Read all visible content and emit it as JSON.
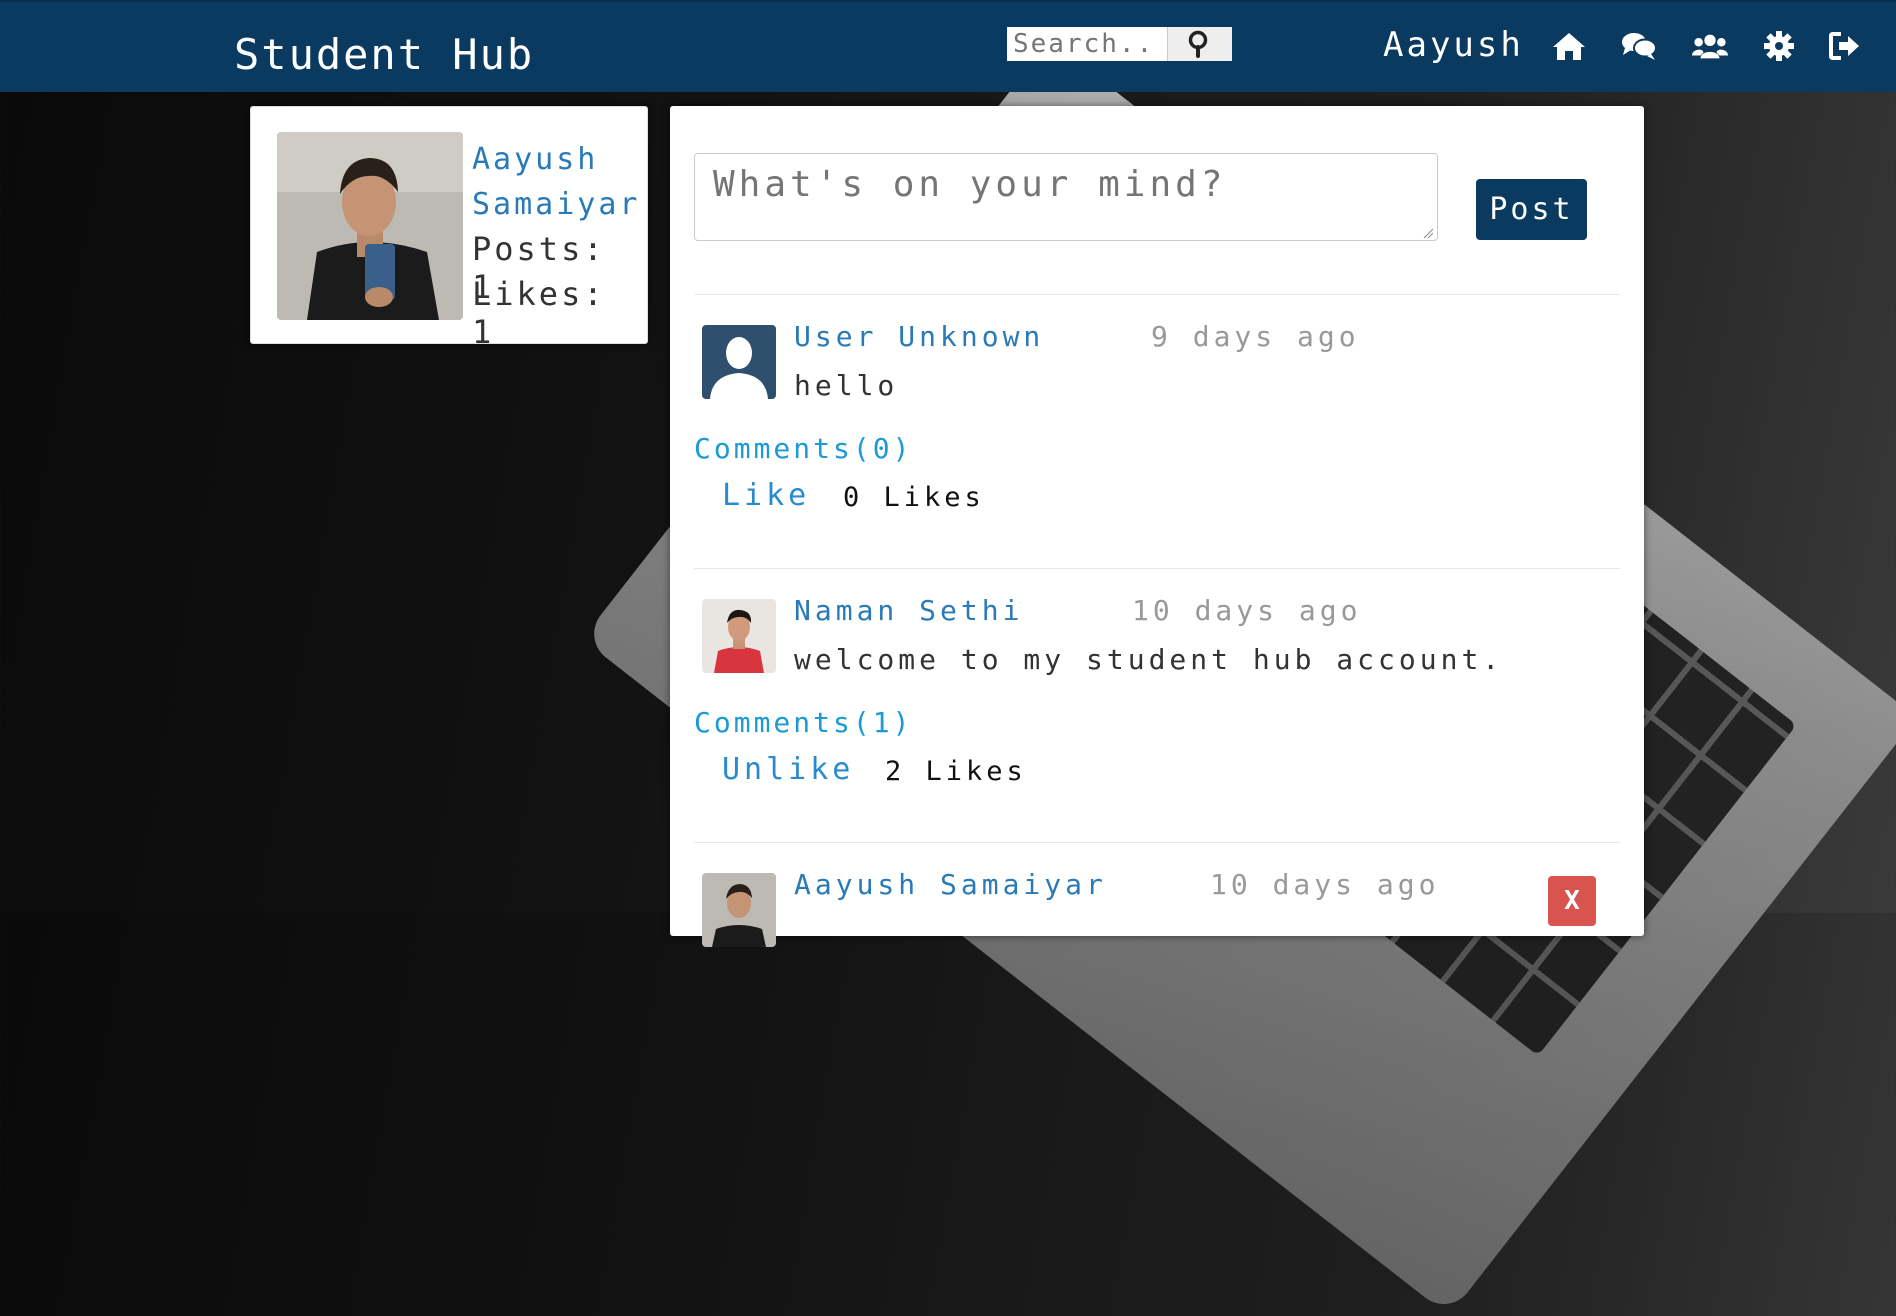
{
  "navbar": {
    "brand": "Student Hub",
    "search_placeholder": "Search..",
    "user_name": "Aayush",
    "icons": [
      "home-icon",
      "chat-icon",
      "users-icon",
      "gear-icon",
      "logout-icon"
    ]
  },
  "profile": {
    "first_name": "Aayush",
    "last_name": "Samaiyar",
    "posts_label": "Posts: 1",
    "likes_label": "Likes: 1"
  },
  "composer": {
    "placeholder": "What's on your mind?",
    "post_label": "Post"
  },
  "posts": [
    {
      "author": "User Unknown",
      "time": "9 days ago",
      "body": "hello",
      "comments_label": "Comments(0)",
      "like_label": "Like",
      "likes_label": "0 Likes"
    },
    {
      "author": "Naman Sethi",
      "time": "10 days ago",
      "body": "welcome to my student hub account.",
      "comments_label": "Comments(1)",
      "like_label": "Unlike",
      "likes_label": "2 Likes"
    },
    {
      "author": "Aayush Samaiyar",
      "time": "10 days ago",
      "delete_label": "X"
    }
  ],
  "colors": {
    "navbar": "#0b3a60",
    "link": "#2a7ab8",
    "comments_link": "#1a9ad6",
    "delete": "#d9534f"
  }
}
